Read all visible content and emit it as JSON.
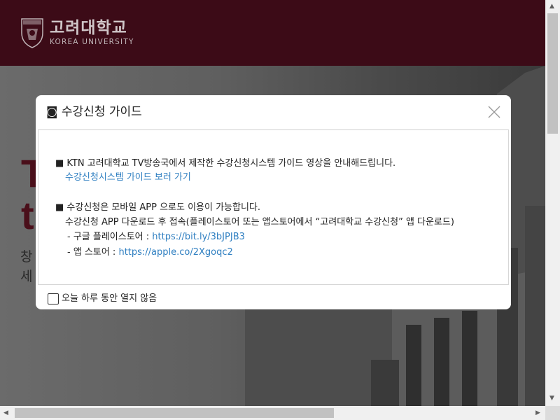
{
  "header": {
    "logo_kr": "고려대학교",
    "logo_en": "KOREA UNIVERSITY"
  },
  "hero": {
    "title_line1": "T",
    "title_line2": "t",
    "sub_line1": "창",
    "sub_line2": "세"
  },
  "modal": {
    "title": "◙ 수강신청 가이드",
    "line1": "■ KTN 고려대학교 TV방송국에서 제작한 수강신청시스템 가이드 영상을 안내해드립니다.",
    "link_guide": "수강신청시스템 가이드 보러 가기",
    "line2": "■ 수강신청은 모바일 APP 으로도 이용이 가능합니다.",
    "line3": "수강신청 APP 다운로드 후 접속(플레이스토어 또는 앱스토어에서 “고려대학교 수강신청” 앱 다운로드)",
    "google_label": "- 구글 플레이스토어 : ",
    "google_link": "https://bit.ly/3bJPJB3",
    "apple_label": "- 앱 스토어 : ",
    "apple_link": "https://apple.co/2Xgoqc2",
    "dont_show_label": "오늘 하루 동안 열지 않음"
  },
  "colors": {
    "header_bg": "#3c0b17",
    "link": "#2f7fc1"
  }
}
